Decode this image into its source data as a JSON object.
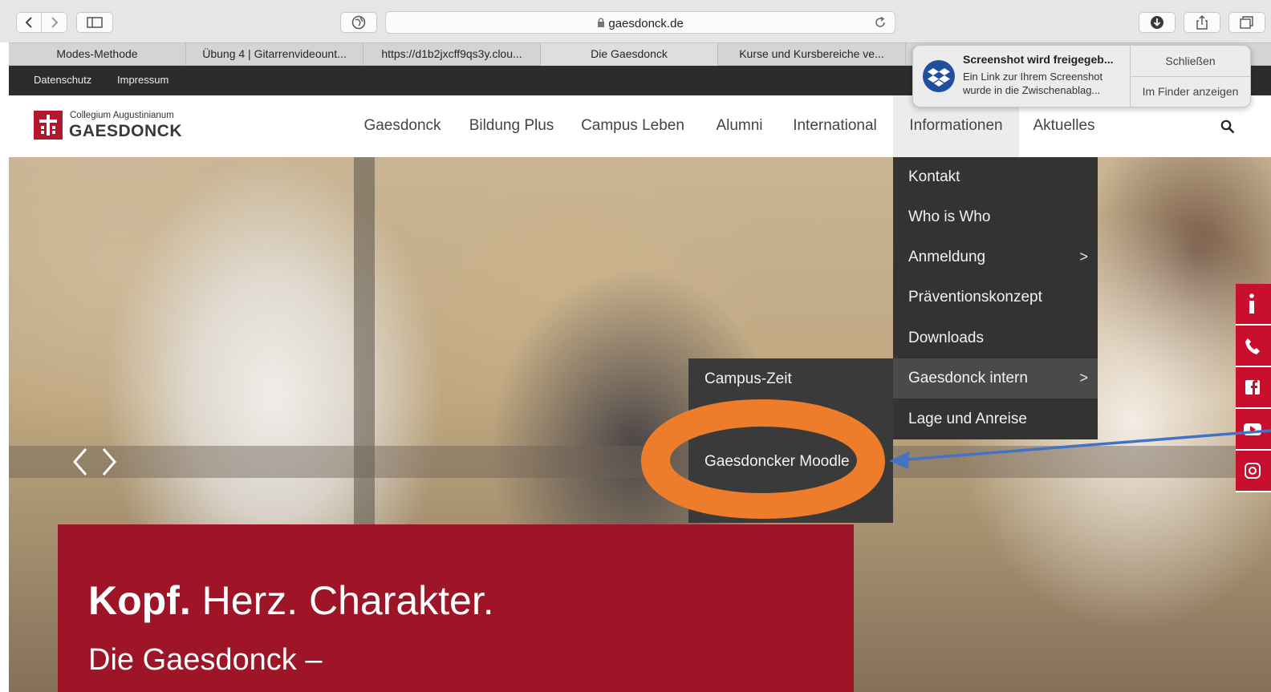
{
  "browser": {
    "url": "gaesdonck.de",
    "tabs": [
      {
        "label": "Modes-Methode"
      },
      {
        "label": "Übung 4 | Gitarrenvideount..."
      },
      {
        "label": "https://d1b2jxcff9qs3y.clou..."
      },
      {
        "label": "Die Gaesdonck"
      },
      {
        "label": "Kurse und Kursbereiche ve..."
      }
    ]
  },
  "site": {
    "topbar": [
      "Datenschutz",
      "Impressum"
    ],
    "logo": {
      "subtitle": "Collegium Augustinianum",
      "title": "GAESDONCK"
    },
    "nav": [
      "Gaesdonck",
      "Bildung Plus",
      "Campus Leben",
      "Alumni",
      "International",
      "Informationen",
      "Aktuelles"
    ],
    "dropdown": [
      {
        "label": "Kontakt"
      },
      {
        "label": "Who is Who"
      },
      {
        "label": "Anmeldung",
        "chevron": ">"
      },
      {
        "label": "Präventionskonzept"
      },
      {
        "label": "Downloads"
      },
      {
        "label": "Gaesdonck intern",
        "chevron": ">"
      },
      {
        "label": "Lage und Anreise"
      }
    ],
    "submenu": [
      "Campus-Zeit",
      "Gaesdoncker Moodle"
    ],
    "hero": {
      "title_bold": "Kopf.",
      "title_rest": " Herz. Charakter.",
      "subtitle": "Die Gaesdonck –"
    },
    "social": [
      "info-icon",
      "phone-icon",
      "facebook-icon",
      "youtube-icon",
      "instagram-icon"
    ]
  },
  "notification": {
    "title": "Screenshot wird freigegeb...",
    "body_line1": "Ein Link zur Ihrem Screenshot",
    "body_line2": "wurde in die Zwischenablag...",
    "close_label": "Schließen",
    "finder_label": "Im Finder anzeigen"
  },
  "colors": {
    "brand_red": "#9e1528",
    "social_red": "#c8102e",
    "menu_dark": "#333333",
    "highlight_orange": "#ee7d2b",
    "arrow_blue": "#4472c4"
  }
}
